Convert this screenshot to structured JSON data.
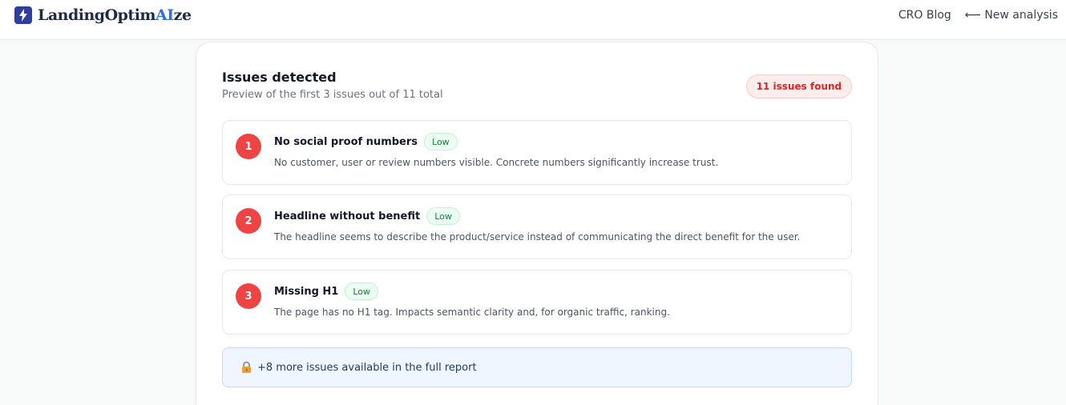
{
  "header": {
    "brand_prefix": "LandingOptim",
    "brand_ai": "AI",
    "brand_suffix": "ze",
    "nav": {
      "blog": "CRO Blog",
      "new_analysis": "⟵ New analysis"
    }
  },
  "issues_panel": {
    "title": "Issues detected",
    "subtitle": "Preview of the first 3 issues out of 11 total",
    "count_badge": "11 issues found",
    "issues": [
      {
        "number": "1",
        "title": "No social proof numbers",
        "severity": "Low",
        "description": "No customer, user or review numbers visible. Concrete numbers significantly increase trust."
      },
      {
        "number": "2",
        "title": "Headline without benefit",
        "severity": "Low",
        "description": "The headline seems to describe the product/service instead of communicating the direct benefit for the user."
      },
      {
        "number": "3",
        "title": "Missing H1",
        "severity": "Low",
        "description": "The page has no H1 tag. Impacts semantic clarity and, for organic traffic, ranking."
      }
    ],
    "more": {
      "icon": "lock-icon",
      "text": "+8 more issues available in the full report"
    }
  },
  "colors": {
    "brand": "#2f3e9e",
    "accent": "#2f6fe0",
    "issue_number": "#ef4444",
    "severity_low": "#15803d",
    "count_badge": "#dc2626"
  }
}
